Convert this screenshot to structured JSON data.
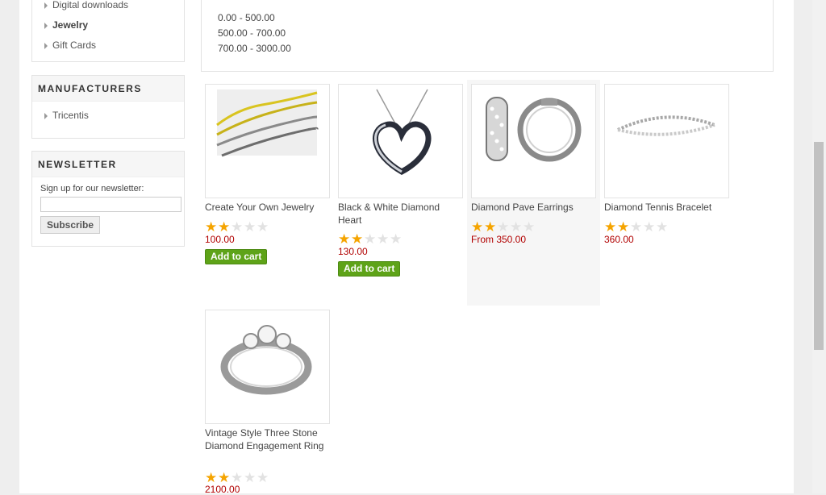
{
  "categories": {
    "items": [
      {
        "label": "Digital downloads"
      },
      {
        "label": "Jewelry"
      },
      {
        "label": "Gift Cards"
      }
    ]
  },
  "manufacturers": {
    "title": "MANUFACTURERS",
    "items": [
      {
        "label": "Tricentis"
      }
    ]
  },
  "newsletter": {
    "title": "NEWSLETTER",
    "prompt": "Sign up for our newsletter:",
    "email_value": "",
    "subscribe_label": "Subscribe"
  },
  "price_filter": {
    "ranges": [
      "0.00 - 500.00",
      "500.00 - 700.00",
      "700.00 - 3000.00"
    ]
  },
  "products": [
    {
      "title": "Create Your Own Jewelry",
      "rating": 2,
      "rating_max": 5,
      "price": "100.00",
      "button": "Add to cart",
      "icon": "chains-image"
    },
    {
      "title": "Black & White Diamond Heart",
      "rating": 2,
      "rating_max": 5,
      "price": "130.00",
      "button": "Add to cart",
      "icon": "heart-pendant-image"
    },
    {
      "title": "Diamond Pave Earrings",
      "rating": 2,
      "rating_max": 5,
      "price": "From 350.00",
      "button": "",
      "icon": "hoop-earrings-image"
    },
    {
      "title": "Diamond Tennis Bracelet",
      "rating": 2,
      "rating_max": 5,
      "price": "360.00",
      "button": "",
      "icon": "tennis-bracelet-image"
    },
    {
      "title": "Vintage Style Three Stone Diamond Engagement Ring",
      "rating": 2,
      "rating_max": 5,
      "price": "2100.00",
      "button": "",
      "icon": "engagement-ring-image"
    }
  ],
  "colors": {
    "price": "#b10000",
    "add_to_cart": "#5ea318",
    "star_on": "#f5a400",
    "star_off": "#e2e2e2"
  }
}
